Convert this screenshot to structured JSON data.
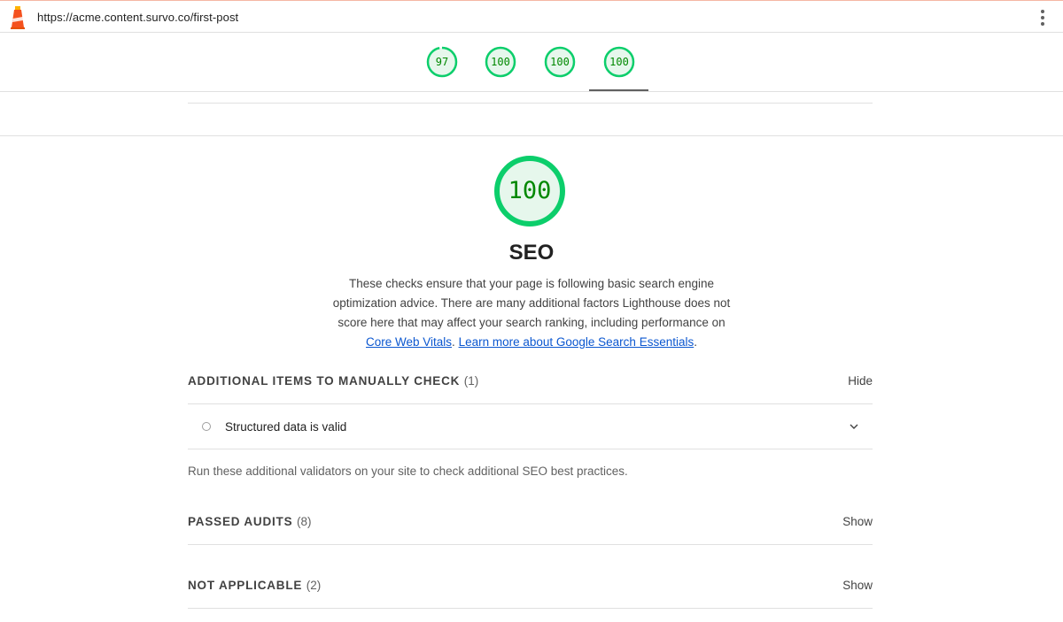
{
  "browser": {
    "url": "https://acme.content.survo.co/first-post",
    "logo_icon": "lighthouse-icon",
    "menu_icon": "more-vert-icon"
  },
  "score_tabs": [
    {
      "value": "97",
      "score": 0.97
    },
    {
      "value": "100",
      "score": 1.0
    },
    {
      "value": "100",
      "score": 1.0
    },
    {
      "value": "100",
      "score": 1.0
    }
  ],
  "active_tab_index": 3,
  "colors": {
    "pass": "#0cce6b",
    "pass_text": "#008800",
    "pass_fill": "#e6f7ec",
    "link": "#0b57d0"
  },
  "category": {
    "score": "100",
    "title": "SEO",
    "description_parts": {
      "text": "These checks ensure that your page is following basic search engine optimization advice. There are many additional factors Lighthouse does not score here that may affect your search ranking, including performance on ",
      "link1": "Core Web Vitals",
      "sep": ". ",
      "link2": "Learn more about Google Search Essentials",
      "end": "."
    }
  },
  "groups": {
    "manual": {
      "title": "ADDITIONAL ITEMS TO MANUALLY CHECK",
      "count": "(1)",
      "toggle": "Hide",
      "audit": "Structured data is valid",
      "description": "Run these additional validators on your site to check additional SEO best practices."
    },
    "passed": {
      "title": "PASSED AUDITS",
      "count": "(8)",
      "toggle": "Show"
    },
    "not_applicable": {
      "title": "NOT APPLICABLE",
      "count": "(2)",
      "toggle": "Show"
    }
  }
}
